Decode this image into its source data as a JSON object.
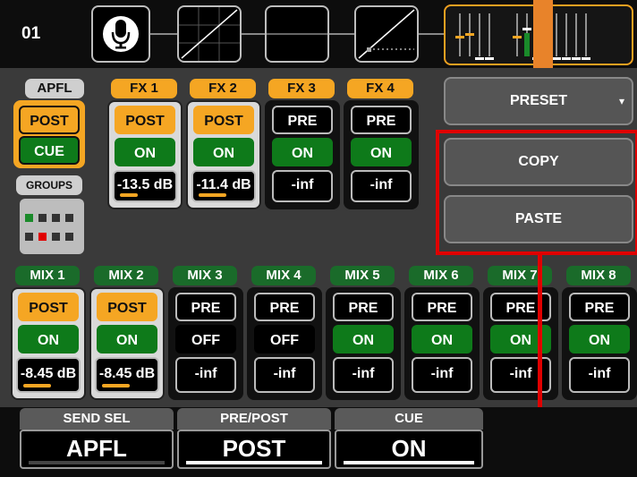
{
  "header": {
    "channel_number": "01",
    "mic_icon": "microphone-icon",
    "curve_icons": [
      "eq-curve-icon",
      "flat-curve-icon",
      "gate-curve-icon"
    ]
  },
  "apfl_section": {
    "label": "APFL",
    "post_label": "POST",
    "cue_label": "CUE",
    "groups_label": "GROUPS"
  },
  "fx_sends": [
    {
      "label": "FX 1",
      "mode": "POST",
      "state": "ON",
      "level": "-13.5 dB",
      "fill": 0.3
    },
    {
      "label": "FX 2",
      "mode": "POST",
      "state": "ON",
      "level": "-11.4 dB",
      "fill": 0.45
    },
    {
      "label": "FX 3",
      "mode": "PRE",
      "state": "ON",
      "level": "-inf",
      "fill": 0
    },
    {
      "label": "FX 4",
      "mode": "PRE",
      "state": "ON",
      "level": "-inf",
      "fill": 0
    }
  ],
  "actions": {
    "preset": "PRESET",
    "copy": "COPY",
    "paste": "PASTE"
  },
  "mix_sends": [
    {
      "label": "MIX 1",
      "mode": "POST",
      "state": "ON",
      "level": "-8.45 dB",
      "fill": 0.45
    },
    {
      "label": "MIX 2",
      "mode": "POST",
      "state": "ON",
      "level": "-8.45 dB",
      "fill": 0.45
    },
    {
      "label": "MIX 3",
      "mode": "PRE",
      "state": "OFF",
      "level": "-inf",
      "fill": 0
    },
    {
      "label": "MIX 4",
      "mode": "PRE",
      "state": "OFF",
      "level": "-inf",
      "fill": 0
    },
    {
      "label": "MIX 5",
      "mode": "PRE",
      "state": "ON",
      "level": "-inf",
      "fill": 0
    },
    {
      "label": "MIX 6",
      "mode": "PRE",
      "state": "ON",
      "level": "-inf",
      "fill": 0
    },
    {
      "label": "MIX 7",
      "mode": "PRE",
      "state": "ON",
      "level": "-inf",
      "fill": 0
    },
    {
      "label": "MIX 8",
      "mode": "PRE",
      "state": "ON",
      "level": "-inf",
      "fill": 0
    }
  ],
  "bottom": {
    "send_sel_label": "SEND SEL",
    "send_sel_value": "APFL",
    "prepost_label": "PRE/POST",
    "prepost_value": "POST",
    "cue_label": "CUE",
    "cue_value": "ON"
  },
  "colors": {
    "accent_orange": "#f5a623",
    "on_green": "#0e7a1a",
    "highlight_red": "#e00000"
  }
}
